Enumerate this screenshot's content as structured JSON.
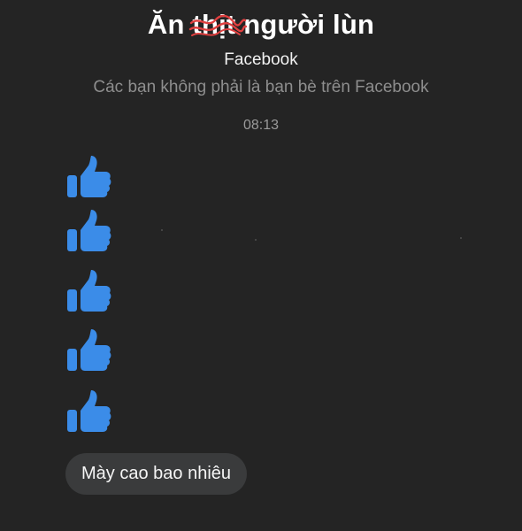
{
  "header": {
    "title_prefix": "Ăn ",
    "title_struck": "thịt",
    "title_suffix": " người lùn",
    "subtitle": "Facebook",
    "notice": "Các bạn không phải là bạn bè trên Facebook"
  },
  "conversation": {
    "timestamp": "08:13",
    "reactions": [
      {
        "icon": "thumbs-up-icon"
      },
      {
        "icon": "thumbs-up-icon"
      },
      {
        "icon": "thumbs-up-icon"
      },
      {
        "icon": "thumbs-up-icon"
      },
      {
        "icon": "thumbs-up-icon"
      }
    ],
    "message": "Mày cao bao nhiêu"
  },
  "colors": {
    "background": "#242424",
    "like_blue": "#3b8ce8",
    "bubble": "#3a3b3c",
    "scribble": "#e04040"
  }
}
